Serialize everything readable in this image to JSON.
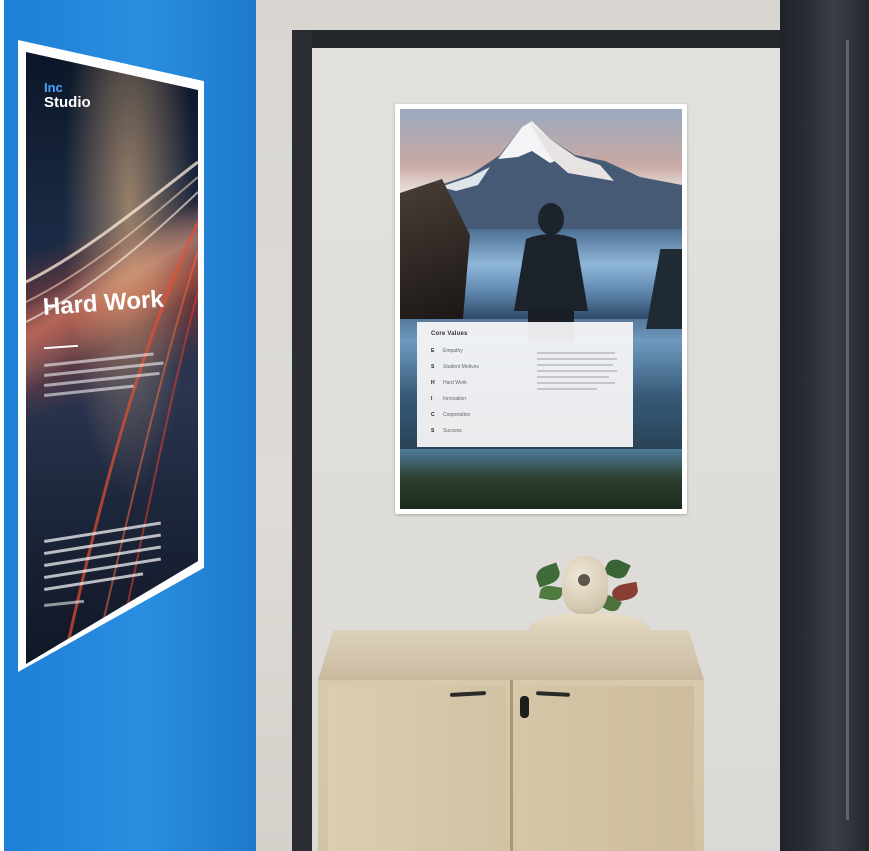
{
  "left_poster": {
    "logo_top": "Inc",
    "logo_bottom": "Studio",
    "title": "Hard Work"
  },
  "right_poster": {
    "panel_title": "Core Values",
    "values": [
      {
        "letter": "E",
        "label": "Empathy"
      },
      {
        "letter": "S",
        "label": "Student Motives"
      },
      {
        "letter": "H",
        "label": "Hard Work"
      },
      {
        "letter": "I",
        "label": "Innovation"
      },
      {
        "letter": "C",
        "label": "Cooperation"
      },
      {
        "letter": "S",
        "label": "Success"
      }
    ]
  },
  "colors": {
    "blue_wall": "#2a8ee0",
    "grey_wall": "#dcdad6",
    "door_frame": "#23262b",
    "cabinet_wood": "#d3c3a5"
  }
}
